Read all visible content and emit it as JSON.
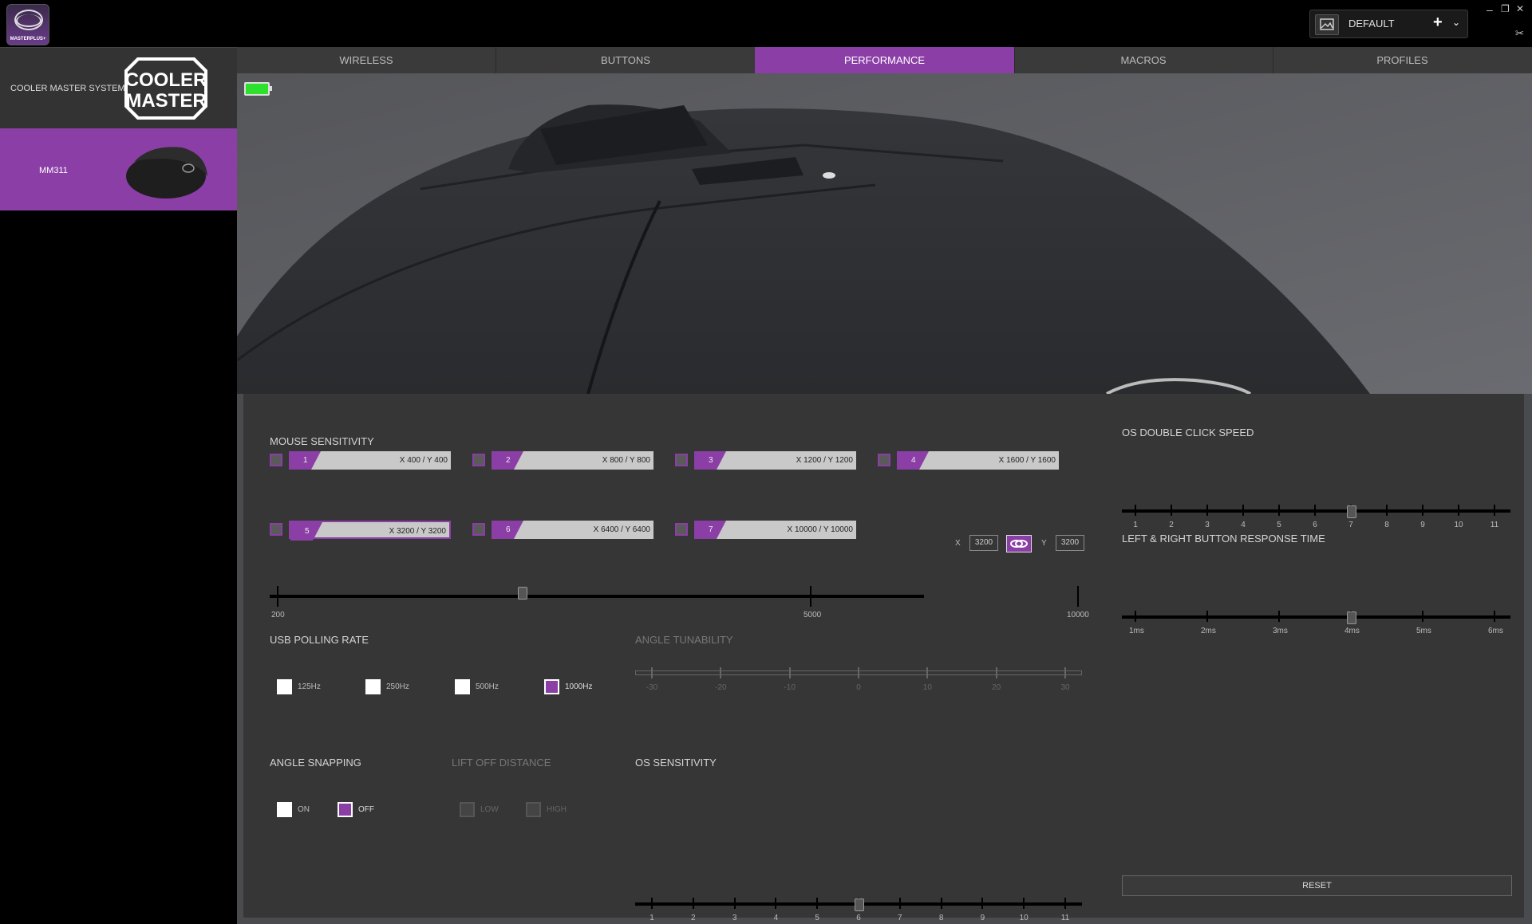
{
  "app": {
    "logo_text": "MASTERPLUS+"
  },
  "profile": {
    "name": "DEFAULT",
    "add": "+",
    "dropdown": "⌄"
  },
  "window": {
    "minimize": "–",
    "restore": "❐",
    "close": "✕",
    "tools": "✂"
  },
  "sidebar": {
    "brand_label": "COOLER MASTER SYSTEM",
    "brand_logo_text": [
      "COOLER",
      "MASTER"
    ],
    "device_label": "MM311"
  },
  "tabs": [
    "WIRELESS",
    "BUTTONS",
    "PERFORMANCE",
    "MACROS",
    "PROFILES"
  ],
  "active_tab": "PERFORMANCE",
  "colors": {
    "accent": "#8b3ea6",
    "battery": "#2ee02e"
  },
  "sensitivity": {
    "title": "MOUSE SENSITIVITY",
    "levels": [
      {
        "n": "1",
        "value": "X 400 / Y 400",
        "selected": false
      },
      {
        "n": "2",
        "value": "X 800 / Y 800",
        "selected": false
      },
      {
        "n": "3",
        "value": "X 1200 / Y 1200",
        "selected": false
      },
      {
        "n": "4",
        "value": "X 1600 / Y 1600",
        "selected": false
      },
      {
        "n": "5",
        "value": "X 3200 / Y 3200",
        "selected": true
      },
      {
        "n": "6",
        "value": "X 6400 / Y 6400",
        "selected": false
      },
      {
        "n": "7",
        "value": "X 10000 / Y 10000",
        "selected": false
      }
    ],
    "x_label": "X",
    "x_value": "3200",
    "y_label": "Y",
    "y_value": "3200",
    "slider_labels": [
      "200",
      "5000",
      "10000"
    ],
    "slider_min": 200,
    "slider_max": 10000,
    "slider_value": 3200
  },
  "polling": {
    "title": "USB POLLING RATE",
    "options": [
      "125Hz",
      "250Hz",
      "500Hz",
      "1000Hz"
    ],
    "selected": "1000Hz"
  },
  "angle_tunability": {
    "title": "ANGLE TUNABILITY",
    "labels": [
      "-30",
      "-20",
      "-10",
      "0",
      "10",
      "20",
      "30"
    ]
  },
  "angle_snapping": {
    "title": "ANGLE SNAPPING",
    "on": "ON",
    "off": "OFF",
    "selected": "OFF"
  },
  "lift_off": {
    "title": "LIFT OFF DISTANCE",
    "low": "LOW",
    "high": "HIGH"
  },
  "os_sensitivity": {
    "title": "OS SENSITIVITY",
    "labels": [
      "1",
      "2",
      "3",
      "4",
      "5",
      "6",
      "7",
      "8",
      "9",
      "10",
      "11"
    ],
    "value": 6
  },
  "double_click": {
    "title": "OS DOUBLE CLICK SPEED",
    "labels": [
      "1",
      "2",
      "3",
      "4",
      "5",
      "6",
      "7",
      "8",
      "9",
      "10",
      "11"
    ],
    "value": 7
  },
  "response_time": {
    "title": "LEFT & RIGHT BUTTON RESPONSE TIME",
    "labels": [
      "1ms",
      "2ms",
      "3ms",
      "4ms",
      "5ms",
      "6ms"
    ],
    "value": "4ms"
  },
  "reset_label": "RESET"
}
